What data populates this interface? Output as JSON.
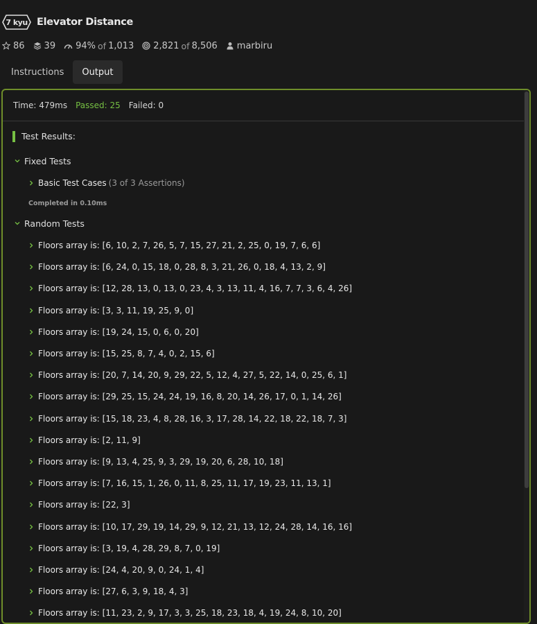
{
  "kata": {
    "rank": "7 kyu",
    "title": "Elevator Distance",
    "stars": "86",
    "collections": "39",
    "satisfaction_pct": "94%",
    "satisfaction_of_label": "of",
    "satisfaction_votes": "1,013",
    "completed": "2,821",
    "completed_of_label": "of",
    "attempted": "8,506",
    "author": "marbiru"
  },
  "tabs": [
    {
      "label": "Instructions",
      "active": false
    },
    {
      "label": "Output",
      "active": true
    }
  ],
  "summary": {
    "time": "Time: 479ms",
    "passed": "Passed: 25",
    "failed": "Failed: 0"
  },
  "results": {
    "heading": "Test Results:",
    "fixed_group": "Fixed Tests",
    "basic_case": "Basic Test Cases",
    "basic_assertions": "(3 of 3 Assertions)",
    "completed_in": "Completed in 0.10ms",
    "random_group": "Random Tests",
    "random_items": [
      "Floors array is: [6, 10, 2, 7, 26, 5, 7, 15, 27, 21, 2, 25, 0, 19, 7, 6, 6]",
      "Floors array is: [6, 24, 0, 15, 18, 0, 28, 8, 3, 21, 26, 0, 18, 4, 13, 2, 9]",
      "Floors array is: [12, 28, 13, 0, 13, 0, 23, 4, 3, 13, 11, 4, 16, 7, 7, 3, 6, 4, 26]",
      "Floors array is: [3, 3, 11, 19, 25, 9, 0]",
      "Floors array is: [19, 24, 15, 0, 6, 0, 20]",
      "Floors array is: [15, 25, 8, 7, 4, 0, 2, 15, 6]",
      "Floors array is: [20, 7, 14, 20, 9, 29, 22, 5, 12, 4, 27, 5, 22, 14, 0, 25, 6, 1]",
      "Floors array is: [29, 25, 15, 24, 24, 19, 16, 8, 20, 14, 26, 17, 0, 1, 14, 26]",
      "Floors array is: [15, 18, 23, 4, 8, 28, 16, 3, 17, 28, 14, 22, 18, 22, 18, 7, 3]",
      "Floors array is: [2, 11, 9]",
      "Floors array is: [9, 13, 4, 25, 9, 3, 29, 19, 20, 6, 28, 10, 18]",
      "Floors array is: [7, 16, 15, 1, 26, 0, 11, 8, 25, 11, 17, 19, 23, 11, 13, 1]",
      "Floors array is: [22, 3]",
      "Floors array is: [10, 17, 29, 19, 14, 29, 9, 12, 21, 13, 12, 24, 28, 14, 16, 16]",
      "Floors array is: [3, 19, 4, 28, 29, 8, 7, 0, 19]",
      "Floors array is: [24, 4, 20, 9, 0, 24, 1, 4]",
      "Floors array is: [27, 6, 3, 9, 18, 4, 3]",
      "Floors array is: [11, 23, 2, 9, 17, 3, 3, 25, 18, 23, 18, 4, 19, 24, 8, 10, 20]"
    ]
  },
  "colors": {
    "accent_green": "#76c043",
    "panel_border": "#6f8e2a",
    "background": "#1a1a1a"
  }
}
